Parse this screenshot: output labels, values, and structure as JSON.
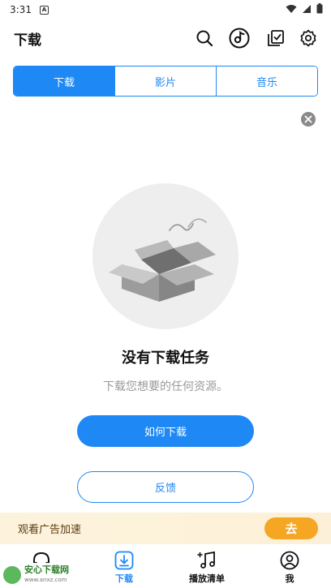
{
  "status_bar": {
    "time": "3:31",
    "a_icon": "A"
  },
  "header": {
    "title": "下载"
  },
  "tabs": [
    {
      "label": "下载",
      "active": true
    },
    {
      "label": "影片",
      "active": false
    },
    {
      "label": "音乐",
      "active": false
    }
  ],
  "empty_state": {
    "title": "没有下载任务",
    "subtitle": "下载您想要的任何资源。",
    "primary_button": "如何下载",
    "secondary_button": "反馈"
  },
  "ad_bar": {
    "text": "观看广告加速",
    "button": "去"
  },
  "bottom_nav": {
    "items": [
      {
        "label": "",
        "icon": "headphones-icon"
      },
      {
        "label": "下载",
        "icon": "download-icon",
        "active": true
      },
      {
        "label": "播放清单",
        "icon": "playlist-icon"
      },
      {
        "label": "我",
        "icon": "profile-icon"
      }
    ]
  },
  "watermark": {
    "name": "安心下载网",
    "url": "www.anxz.com"
  },
  "colors": {
    "accent": "#1e88f5",
    "ad_button": "#f5a623",
    "ad_background": "#fdf3dc"
  }
}
